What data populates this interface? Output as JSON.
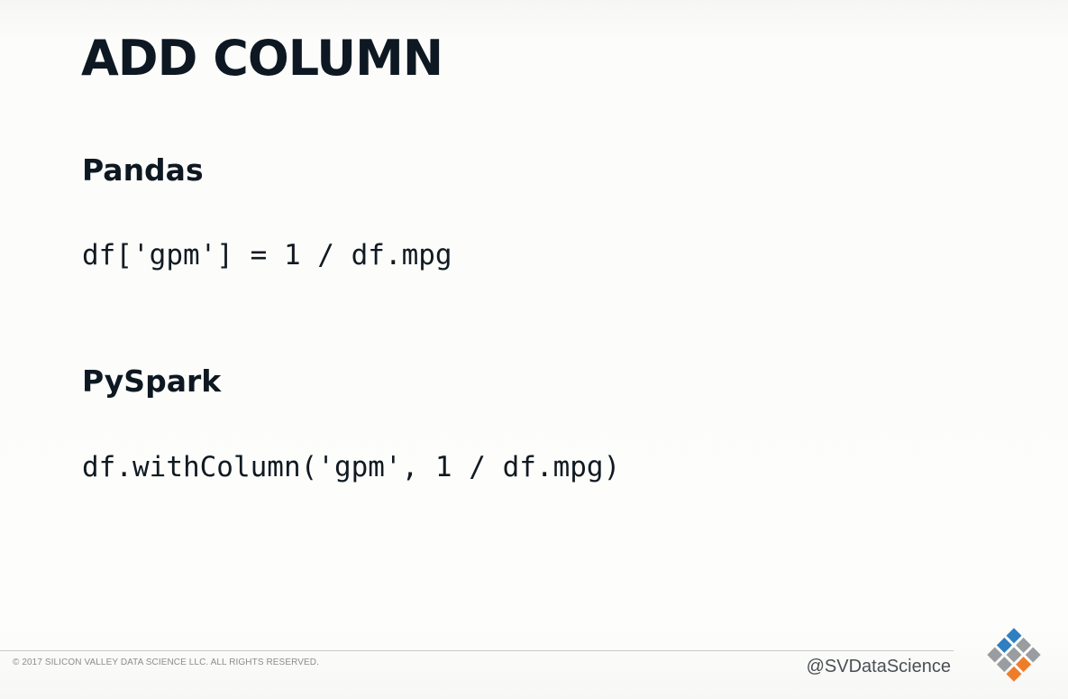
{
  "slide": {
    "title": "ADD COLUMN",
    "sections": [
      {
        "heading": "Pandas",
        "code": "df['gpm'] = 1 / df.mpg"
      },
      {
        "heading": "PySpark",
        "code": "df.withColumn('gpm', 1 / df.mpg)"
      }
    ]
  },
  "footer": {
    "copyright": "© 2017 SILICON VALLEY DATA SCIENCE LLC. ALL RIGHTS RESERVED.",
    "handle": "@SVDataScience",
    "logo_icon": "svds-diamond-grid-logo-icon"
  },
  "colors": {
    "logo_blue": "#2f7fc1",
    "logo_orange": "#ee7d2a",
    "logo_gray": "#9a9da0"
  }
}
